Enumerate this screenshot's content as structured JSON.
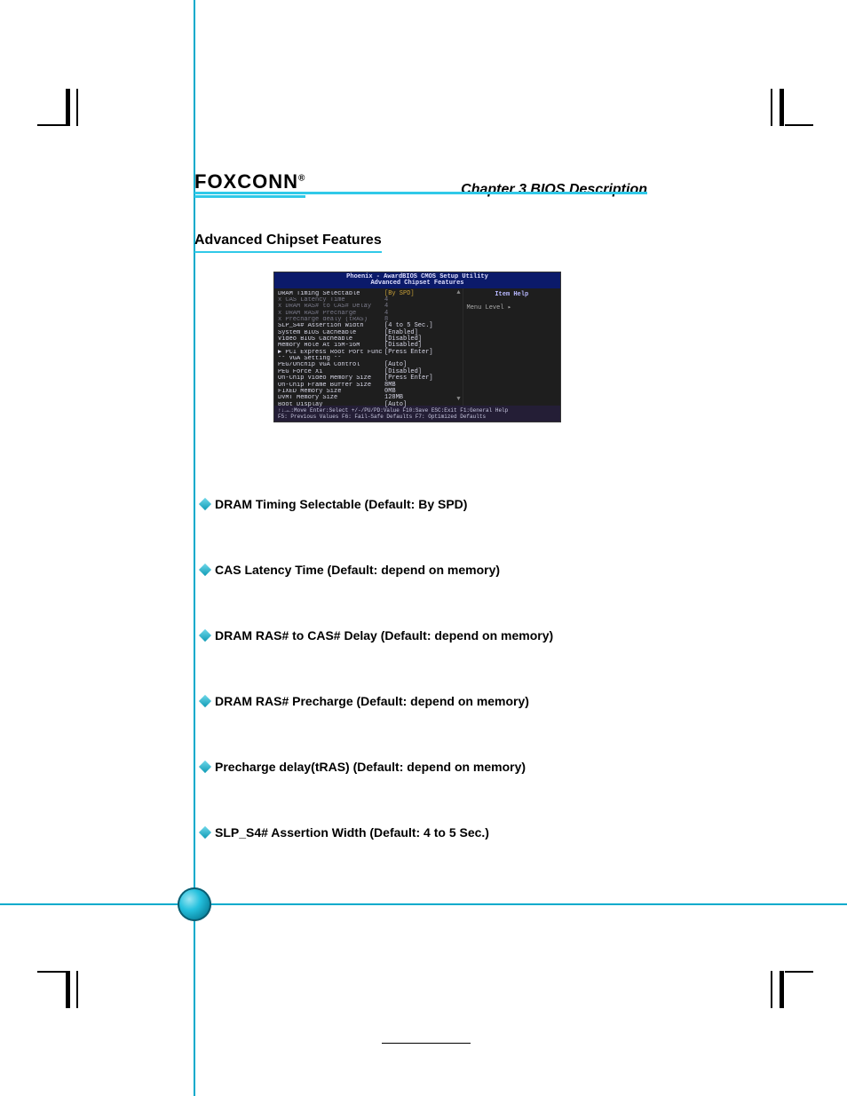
{
  "header": {
    "logo": "FOXCONN",
    "logo_mark": "®",
    "chapter": "Chapter 3    BIOS Description"
  },
  "section_title": "Advanced Chipset Features",
  "bios": {
    "title_line1": "Phoenix - AwardBIOS CMOS Setup Utility",
    "title_line2": "Advanced Chipset Features",
    "help_title": "Item Help",
    "menu_level": "Menu Level   ▸",
    "rows": [
      {
        "label": "DRAM Timing Selectable",
        "value": "[By SPD]",
        "dim": false,
        "hi": true
      },
      {
        "label": "x CAS Latency Time",
        "value": "4",
        "dim": true,
        "hi": false
      },
      {
        "label": "x DRAM RAS# to CAS# Delay",
        "value": "4",
        "dim": true,
        "hi": false
      },
      {
        "label": "x DRAM RAS# Precharge",
        "value": "4",
        "dim": true,
        "hi": false
      },
      {
        "label": "x Precharge dealy (tRAS)",
        "value": "8",
        "dim": true,
        "hi": false
      },
      {
        "label": "SLP_S4# Assertion Width",
        "value": "[4 to 5 Sec.]",
        "dim": false,
        "hi": false
      },
      {
        "label": "System BIOS Cacheable",
        "value": "[Enabled]",
        "dim": false,
        "hi": false
      },
      {
        "label": "Video  BIOS Cacheable",
        "value": "[Disabled]",
        "dim": false,
        "hi": false
      },
      {
        "label": "Memory Hole At 15M-16M",
        "value": "[Disabled]",
        "dim": false,
        "hi": false
      },
      {
        "label": "▶ PCI Express Root Port Func",
        "value": "[Press Enter]",
        "dim": false,
        "hi": false
      },
      {
        "label": "",
        "value": "",
        "dim": true,
        "hi": false
      },
      {
        "label": "** VGA Setting **",
        "value": "",
        "dim": false,
        "hi": false
      },
      {
        "label": "PEG/Onchip VGA Control",
        "value": "[Auto]",
        "dim": false,
        "hi": false
      },
      {
        "label": "PEG Force X1",
        "value": "[Disabled]",
        "dim": false,
        "hi": false
      },
      {
        "label": "On-Chip Video Memory Size",
        "value": "[Press Enter]",
        "dim": false,
        "hi": false
      },
      {
        "label": "On-Chip Frame Buffer Size",
        "value": " 8MB",
        "dim": false,
        "hi": false
      },
      {
        "label": "FIXED Memory Size",
        "value": " 0MB",
        "dim": false,
        "hi": false
      },
      {
        "label": "DVMT Memory Size",
        "value": "128MB",
        "dim": false,
        "hi": false
      },
      {
        "label": "Boot Display",
        "value": "[Auto]",
        "dim": false,
        "hi": false
      }
    ],
    "footer_line1": "↑↓→←:Move  Enter:Select  +/-/PU/PD:Value  F10:Save  ESC:Exit  F1:General Help",
    "footer_line2": "F5: Previous Values    F6: Fail-Safe Defaults    F7: Optimized Defaults"
  },
  "bullets": [
    "DRAM Timing Selectable (Default: By SPD)",
    "CAS Latency Time (Default: depend on memory)",
    "DRAM RAS# to CAS# Delay (Default: depend on memory)",
    "DRAM RAS# Precharge (Default: depend on memory)",
    "Precharge delay(tRAS) (Default: depend on memory)",
    "SLP_S4# Assertion Width (Default: 4 to 5 Sec.)"
  ]
}
